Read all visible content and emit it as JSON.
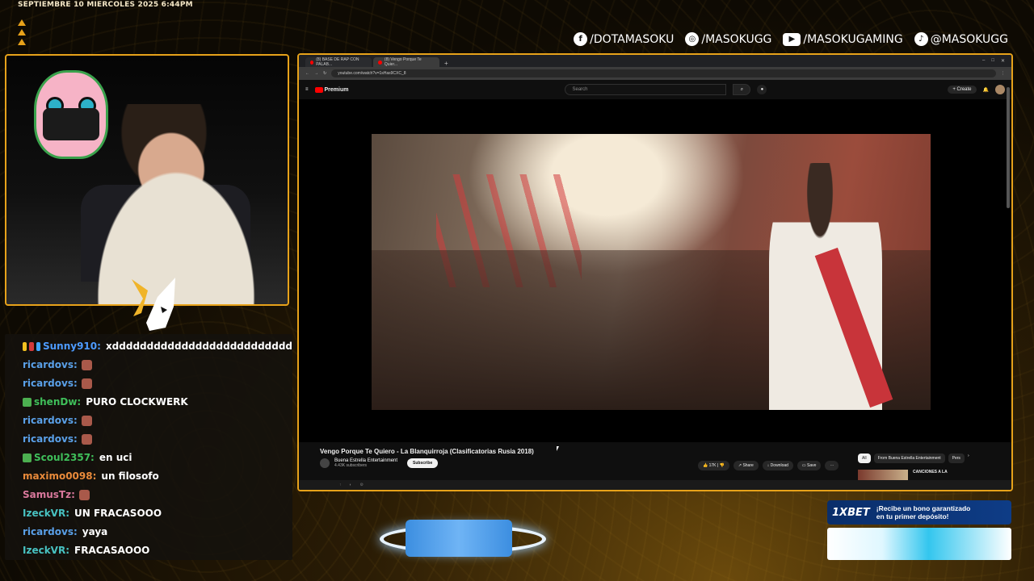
{
  "overlay": {
    "datetime": "SEPTIEMBRE 10 MIERCOLES 2025 6:44PM",
    "socials": [
      {
        "icon": "facebook-icon",
        "glyph": "f",
        "handle": "/DOTAMASOKU"
      },
      {
        "icon": "instagram-icon",
        "glyph": "◎",
        "handle": "/MASOKUGG"
      },
      {
        "icon": "youtube-icon",
        "glyph": "▶",
        "handle": "/MASOKUGAMING"
      },
      {
        "icon": "tiktok-icon",
        "glyph": "♪",
        "handle": "@MASOKUGG"
      }
    ]
  },
  "chat": {
    "messages": [
      {
        "user": "Sunny910:",
        "color": "#4d9bff",
        "text": "xdddddddddddddddddddddddddd",
        "badges": [
          "#f0c020",
          "#d23a3a",
          "#3fa6ff"
        ],
        "emote": false
      },
      {
        "user": "ricardovs:",
        "color": "#5aa0e8",
        "text": "",
        "badges": [],
        "emote": true
      },
      {
        "user": "ricardovs:",
        "color": "#5aa0e8",
        "text": "",
        "badges": [],
        "emote": true
      },
      {
        "user": "shenDw:",
        "color": "#3fbf5a",
        "text": "PURO CLOCKWERK",
        "badges": [
          "#4caf50"
        ],
        "emote": false
      },
      {
        "user": "ricardovs:",
        "color": "#5aa0e8",
        "text": "",
        "badges": [],
        "emote": true
      },
      {
        "user": "ricardovs:",
        "color": "#5aa0e8",
        "text": "",
        "badges": [],
        "emote": true
      },
      {
        "user": "Scoul2357:",
        "color": "#3fbf5a",
        "text": "en uci",
        "badges": [
          "#4caf50"
        ],
        "emote": false
      },
      {
        "user": "maximo0098:",
        "color": "#e98a3a",
        "text": "un filosofo",
        "badges": [],
        "emote": false
      },
      {
        "user": "SamusTz:",
        "color": "#d9789c",
        "text": "",
        "badges": [],
        "emote": true
      },
      {
        "user": "IzeckVR:",
        "color": "#48c2c2",
        "text": "UN FRACASOOO",
        "badges": [],
        "emote": false
      },
      {
        "user": "ricardovs:",
        "color": "#5aa0e8",
        "text": "yaya",
        "badges": [],
        "emote": false
      },
      {
        "user": "IzeckVR:",
        "color": "#48c2c2",
        "text": "FRACASAOOO",
        "badges": [],
        "emote": false
      }
    ]
  },
  "browser": {
    "tabs": [
      {
        "label": "(8) BASE DE RAP CON PALAB...",
        "active": false
      },
      {
        "label": "(8) Vengo Porque Te Quier...",
        "active": true
      }
    ],
    "url": "youtube.com/watch?v=1sHas9CXC_8",
    "youtube": {
      "logo": "Premium",
      "search_placeholder": "Search",
      "create_label": "Create",
      "video_title": "Vengo Porque Te Quiero - La Blanquirroja (Clasificatorias Rusia 2018)",
      "channel_name": "Buena Estrella Entertainment",
      "channel_subs": "4.43K subscribers",
      "subscribe_label": "Subscribe",
      "likes": "17K",
      "share_label": "Share",
      "download_label": "Download",
      "save_label": "Save",
      "chips": [
        "All",
        "From Buena Estrella Entertainment",
        "Pers"
      ],
      "rec_title": "CANCIONES A LA"
    }
  },
  "sponsor": {
    "brand": "1XBET",
    "message": "¡Recibe un bono garantizado en tu primer depósito!"
  }
}
